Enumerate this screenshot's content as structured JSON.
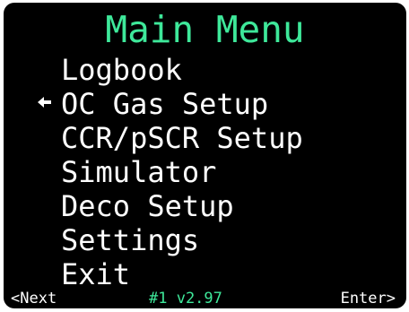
{
  "title": "Main Menu",
  "cursor_icon": "arrow-right-icon",
  "cursor_glyph": "◆",
  "menu": {
    "items": [
      {
        "label": "Logbook",
        "selected": false
      },
      {
        "label": "OC Gas Setup",
        "selected": true
      },
      {
        "label": "CCR/pSCR Setup",
        "selected": false
      },
      {
        "label": "Simulator",
        "selected": false
      },
      {
        "label": "Deco Setup",
        "selected": false
      },
      {
        "label": "Settings",
        "selected": false
      },
      {
        "label": "Exit",
        "selected": false
      }
    ]
  },
  "status": {
    "left": "<Next",
    "center": "#1 v2.97",
    "right": "Enter>"
  },
  "colors": {
    "accent": "#3ee89a",
    "text": "#ffffff",
    "background": "#000000"
  }
}
